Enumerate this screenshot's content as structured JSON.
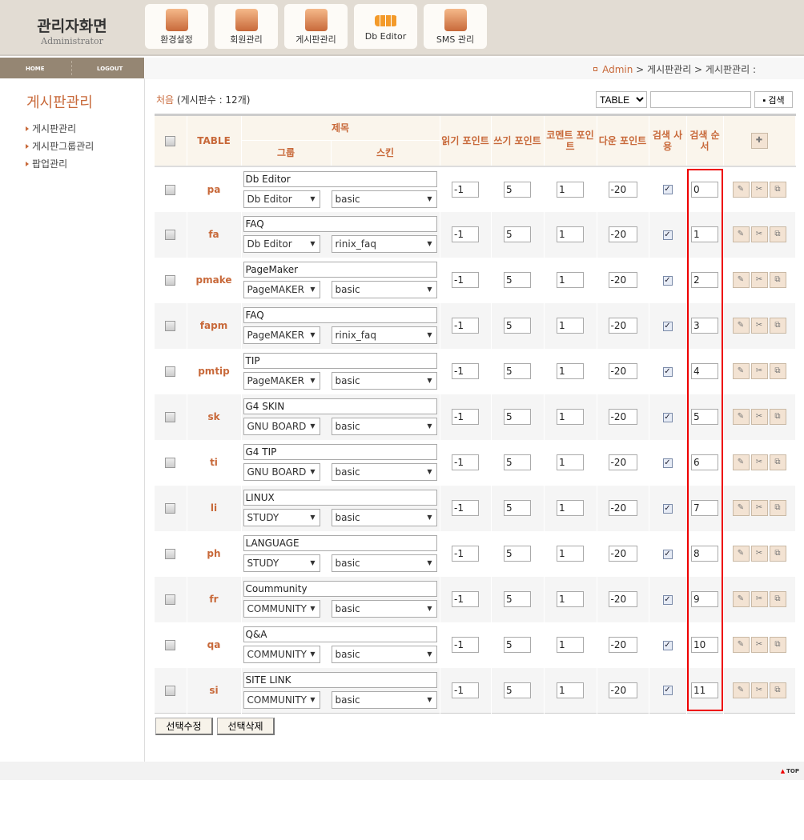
{
  "header": {
    "title": "관리자화면",
    "subtitle": "Administrator",
    "menus": [
      {
        "label": "환경설정",
        "icon": "monitor-icon"
      },
      {
        "label": "회원관리",
        "icon": "members-icon"
      },
      {
        "label": "게시판관리",
        "icon": "board-icon"
      },
      {
        "label": "Db Editor",
        "icon": "grid-icon"
      },
      {
        "label": "SMS 관리",
        "icon": "phone-icon"
      }
    ]
  },
  "nav": {
    "home": "HOME",
    "logout": "LOGOUT"
  },
  "sidebar": {
    "title": "게시판관리",
    "items": [
      "게시판관리",
      "게시판그룹관리",
      "팝업관리"
    ]
  },
  "breadcrumb": {
    "admin": "Admin",
    "rest": " > 게시판관리 > 게시판관리 :"
  },
  "list": {
    "first": "처음",
    "count": " (게시판수 : 12개)"
  },
  "search": {
    "field": "TABLE",
    "value": "",
    "button": "검색"
  },
  "columns": {
    "table": "TABLE",
    "title": "제목",
    "group": "그룹",
    "skin": "스킨",
    "read": "읽기 포인트",
    "write": "쓰기 포인트",
    "comment": "코멘트 포인트",
    "down": "다운 포인트",
    "search_use": "검색 사용",
    "search_order": "검색 순서"
  },
  "rows": [
    {
      "table": "pa",
      "title": "Db Editor",
      "group": "Db Editor",
      "skin": "basic",
      "read": "-1",
      "write": "5",
      "comment": "1",
      "down": "-20",
      "order": "0"
    },
    {
      "table": "fa",
      "title": "FAQ",
      "group": "Db Editor",
      "skin": "rinix_faq",
      "read": "-1",
      "write": "5",
      "comment": "1",
      "down": "-20",
      "order": "1"
    },
    {
      "table": "pmake",
      "title": "PageMaker",
      "group": "PageMAKER",
      "skin": "basic",
      "read": "-1",
      "write": "5",
      "comment": "1",
      "down": "-20",
      "order": "2"
    },
    {
      "table": "fapm",
      "title": "FAQ",
      "group": "PageMAKER",
      "skin": "rinix_faq",
      "read": "-1",
      "write": "5",
      "comment": "1",
      "down": "-20",
      "order": "3"
    },
    {
      "table": "pmtip",
      "title": "TIP",
      "group": "PageMAKER",
      "skin": "basic",
      "read": "-1",
      "write": "5",
      "comment": "1",
      "down": "-20",
      "order": "4"
    },
    {
      "table": "sk",
      "title": "G4 SKIN",
      "group": "GNU BOARD",
      "skin": "basic",
      "read": "-1",
      "write": "5",
      "comment": "1",
      "down": "-20",
      "order": "5"
    },
    {
      "table": "ti",
      "title": "G4 TIP",
      "group": "GNU BOARD",
      "skin": "basic",
      "read": "-1",
      "write": "5",
      "comment": "1",
      "down": "-20",
      "order": "6"
    },
    {
      "table": "li",
      "title": "LINUX",
      "group": "STUDY",
      "skin": "basic",
      "read": "-1",
      "write": "5",
      "comment": "1",
      "down": "-20",
      "order": "7"
    },
    {
      "table": "ph",
      "title": "LANGUAGE",
      "group": "STUDY",
      "skin": "basic",
      "read": "-1",
      "write": "5",
      "comment": "1",
      "down": "-20",
      "order": "8"
    },
    {
      "table": "fr",
      "title": "Coummunity",
      "group": "COMMUNITY",
      "skin": "basic",
      "read": "-1",
      "write": "5",
      "comment": "1",
      "down": "-20",
      "order": "9"
    },
    {
      "table": "qa",
      "title": "Q&A",
      "group": "COMMUNITY",
      "skin": "basic",
      "read": "-1",
      "write": "5",
      "comment": "1",
      "down": "-20",
      "order": "10"
    },
    {
      "table": "si",
      "title": "SITE LINK",
      "group": "COMMUNITY",
      "skin": "basic",
      "read": "-1",
      "write": "5",
      "comment": "1",
      "down": "-20",
      "order": "11"
    }
  ],
  "buttons": {
    "edit_selected": "선택수정",
    "delete_selected": "선택삭제"
  },
  "footer": {
    "top": "TOP"
  },
  "colors": {
    "accent": "#c8693a",
    "header_bg": "#e2dcd3",
    "nav_bg": "#958673",
    "highlight": "#e00000"
  }
}
